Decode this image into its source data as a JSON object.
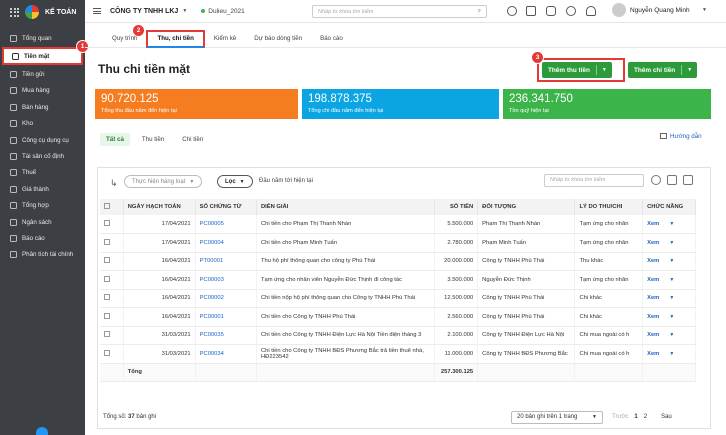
{
  "app": {
    "logo_text": "KẾ TOÁN"
  },
  "topbar": {
    "company": "CÔNG TY TNHH LKJ",
    "db": "Dulieu_2021",
    "search_placeholder": "Nhập từ khóa tìm kiếm",
    "user": "Nguyễn Quang Minh"
  },
  "sidebar": {
    "items": [
      "Tổng quan",
      "Tiền mặt",
      "Tiền gửi",
      "Mua hàng",
      "Bán hàng",
      "Kho",
      "Công cụ dụng cụ",
      "Tài sản cố định",
      "Thuế",
      "Giá thành",
      "Tổng hợp",
      "Ngân sách",
      "Báo cáo",
      "Phân tích tài chính"
    ]
  },
  "tabs": [
    "Quy trình",
    "Thu, chi tiền",
    "Kiểm kê",
    "Dự báo dòng tiền",
    "Báo cáo"
  ],
  "page_title": "Thu chi tiền mặt",
  "buttons": {
    "add_receipt": "Thêm thu tiền",
    "add_payment": "Thêm chi tiền"
  },
  "badges": [
    "1",
    "2",
    "3"
  ],
  "cards": [
    {
      "value": "90.720.125",
      "label": "Tổng thu đầu năm đến hiện tại",
      "color": "#f57c1f"
    },
    {
      "value": "198.878.375",
      "label": "Tổng chi đầu năm đến hiện tại",
      "color": "#0aa5e2"
    },
    {
      "value": "236.341.750",
      "label": "Tồn quỹ hiện tại",
      "color": "#3bb54a"
    }
  ],
  "subtabs": [
    "Tất cả",
    "Thu tiền",
    "Chi tiền"
  ],
  "guide": "Hướng dẫn",
  "toolbar": {
    "batch": "Thực hiện hàng loạt",
    "filter": "Lọc",
    "period": "Đầu năm tới hiện tại",
    "search_placeholder": "Nhập từ khóa tìm kiếm"
  },
  "table": {
    "headers": [
      "NGÀY HẠCH TOÁN",
      "SỐ CHỨNG TỪ",
      "DIỄN GIẢI",
      "SỐ TIỀN",
      "ĐỐI TƯỢNG",
      "LÝ DO THU/CHI",
      "CHỨC NĂNG"
    ],
    "rows": [
      {
        "date": "17/04/2021",
        "doc": "PC00005",
        "desc": "Chi tiền cho Phạm Thị Thanh Nhàn",
        "amount": "5.500.000",
        "obj": "Phạm Thị Thanh Nhàn",
        "reason": "Tạm ứng cho nhân"
      },
      {
        "date": "17/04/2021",
        "doc": "PC00004",
        "desc": "Chi tiền cho Phạm Minh Tuấn",
        "amount": "2.780.000",
        "obj": "Phạm Minh Tuấn",
        "reason": "Tạm ứng cho nhân"
      },
      {
        "date": "16/04/2021",
        "doc": "PT00001",
        "desc": "Thu hộ phí thông quan cho công ty Phú Thái",
        "amount": "20.000.000",
        "obj": "Công ty TNHH Phú Thái",
        "reason": "Thu khác"
      },
      {
        "date": "16/04/2021",
        "doc": "PC00003",
        "desc": "Tạm ứng cho nhân viên Nguyễn Đức Thịnh đi công tác",
        "amount": "3.500.000",
        "obj": "Nguyễn Đức Thịnh",
        "reason": "Tạm ứng cho nhân"
      },
      {
        "date": "16/04/2021",
        "doc": "PC00002",
        "desc": "Chi tiền nộp hộ phí thông quan cho Công ty TNHH Phú Thái",
        "amount": "12.500.000",
        "obj": "Công ty TNHH Phú Thái",
        "reason": "Chi khác"
      },
      {
        "date": "16/04/2021",
        "doc": "PC00001",
        "desc": "Chi tiền cho Công ty TNHH Phú Thái",
        "amount": "2.560.000",
        "obj": "Công ty TNHH Phú Thái",
        "reason": "Chi khác"
      },
      {
        "date": "31/03/2021",
        "doc": "PC00035",
        "desc": "Chi tiền cho Công ty TNHH Điện Lực Hà Nội Tiền điện tháng 3",
        "amount": "2.100.000",
        "obj": "Công ty TNHH Điện Lực Hà Nội",
        "reason": "Chi mua ngoài có h"
      },
      {
        "date": "31/03/2021",
        "doc": "PC00034",
        "desc": "Chi tiền cho Công ty TNHH BĐS Phương Bắc trả tiền thuê nhà, HĐ223542",
        "amount": "11.000.000",
        "obj": "Công ty TNHH BĐS Phương Bắc",
        "reason": "Chi mua ngoài có h"
      }
    ],
    "action": "Xem",
    "total_label": "Tổng",
    "total_amount": "257.300.125"
  },
  "footer": {
    "total_prefix": "Tổng số:",
    "total_count": "37",
    "total_suffix": "bản ghi",
    "page_size": "20 bản ghi trên 1 trang",
    "prev": "Trước",
    "page1": "1",
    "page2": "2",
    "next": "Sau"
  }
}
